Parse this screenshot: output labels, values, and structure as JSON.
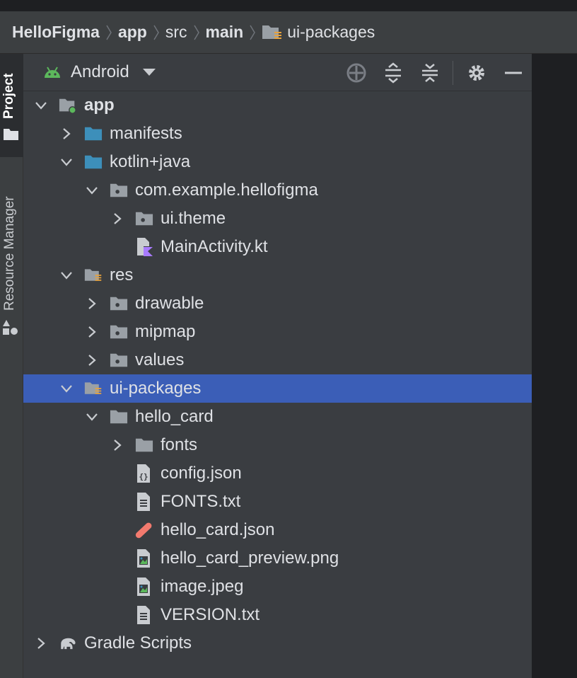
{
  "breadcrumb": [
    "HelloFigma",
    "app",
    "src",
    "main",
    "ui-packages"
  ],
  "tool_window_stripe": {
    "project_tab": "Project",
    "resource_manager_tab": "Resource Manager"
  },
  "panel": {
    "view_mode": "Android"
  },
  "tree": [
    {
      "label": "app",
      "depth": 0,
      "expanded": true,
      "icon": "module-folder-icon",
      "bold": true
    },
    {
      "label": "manifests",
      "depth": 1,
      "expanded": false,
      "icon": "folder-blue-icon"
    },
    {
      "label": "kotlin+java",
      "depth": 1,
      "expanded": true,
      "icon": "folder-blue-icon"
    },
    {
      "label": "com.example.hellofigma",
      "depth": 2,
      "expanded": true,
      "icon": "package-folder-icon"
    },
    {
      "label": "ui.theme",
      "depth": 3,
      "expanded": false,
      "icon": "package-folder-icon"
    },
    {
      "label": "MainActivity.kt",
      "depth": 3,
      "icon": "kotlin-file-icon"
    },
    {
      "label": "res",
      "depth": 1,
      "expanded": true,
      "icon": "resource-folder-icon"
    },
    {
      "label": "drawable",
      "depth": 2,
      "expanded": false,
      "icon": "package-folder-icon"
    },
    {
      "label": "mipmap",
      "depth": 2,
      "expanded": false,
      "icon": "package-folder-icon"
    },
    {
      "label": "values",
      "depth": 2,
      "expanded": false,
      "icon": "package-folder-icon"
    },
    {
      "label": "ui-packages",
      "depth": 1,
      "expanded": true,
      "icon": "resource-folder-icon",
      "selected": true
    },
    {
      "label": "hello_card",
      "depth": 2,
      "expanded": true,
      "icon": "folder-gray-icon"
    },
    {
      "label": "fonts",
      "depth": 3,
      "expanded": false,
      "icon": "folder-gray-icon"
    },
    {
      "label": "config.json",
      "depth": 3,
      "icon": "json-file-icon"
    },
    {
      "label": "FONTS.txt",
      "depth": 3,
      "icon": "text-file-icon"
    },
    {
      "label": "hello_card.json",
      "depth": 3,
      "icon": "figma-file-icon"
    },
    {
      "label": "hello_card_preview.png",
      "depth": 3,
      "icon": "image-file-icon"
    },
    {
      "label": "image.jpeg",
      "depth": 3,
      "icon": "image-file-icon"
    },
    {
      "label": "VERSION.txt",
      "depth": 3,
      "icon": "text-file-icon"
    },
    {
      "label": "Gradle Scripts",
      "depth": 0,
      "expanded": false,
      "icon": "gradle-elephant-icon"
    }
  ],
  "colors": {
    "selection": "#3b5eb7",
    "android_green": "#5cb85c",
    "folder_blue": "#3d8fba",
    "folder_gray": "#9aa0a6",
    "figma_salmon": "#f27a6e",
    "kotlin_purple": "#a97bff"
  }
}
